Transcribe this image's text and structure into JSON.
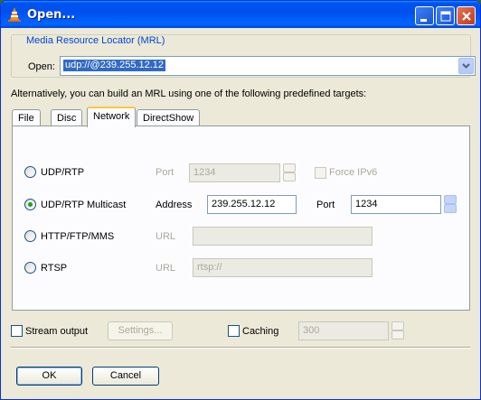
{
  "window": {
    "title": "Open..."
  },
  "mrl": {
    "legend": "Media Resource Locator (MRL)",
    "open_label": "Open:",
    "open_value": "udp://@239.255.12.12"
  },
  "alt_text": "Alternatively, you can build an MRL using one of the following predefined targets:",
  "tabs": [
    "File",
    "Disc",
    "Network",
    "DirectShow"
  ],
  "active_tab": "Network",
  "network": {
    "udp": {
      "label": "UDP/RTP",
      "port_label": "Port",
      "port_value": "1234",
      "ipv6_label": "Force IPv6"
    },
    "multicast": {
      "label": "UDP/RTP Multicast",
      "address_label": "Address",
      "address_value": "239.255.12.12",
      "port_label": "Port",
      "port_value": "1234"
    },
    "http": {
      "label": "HTTP/FTP/MMS",
      "url_label": "URL",
      "url_value": ""
    },
    "rtsp": {
      "label": "RTSP",
      "url_label": "URL",
      "url_value": "rtsp://"
    }
  },
  "bottom": {
    "stream_output_label": "Stream output",
    "settings_label": "Settings...",
    "caching_label": "Caching",
    "caching_value": "300"
  },
  "buttons": {
    "ok": "OK",
    "cancel": "Cancel"
  },
  "colors": {
    "title_bar": "#0053ee",
    "dialog_bg": "#ece9d8",
    "selection": "#316ac5"
  }
}
